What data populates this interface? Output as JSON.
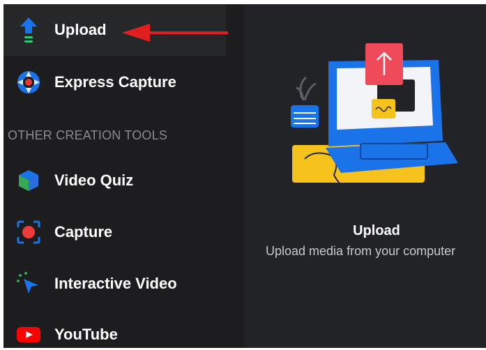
{
  "sidebar": {
    "items": [
      {
        "label": "Upload",
        "icon": "upload-icon"
      },
      {
        "label": "Express Capture",
        "icon": "express-capture-icon"
      }
    ],
    "section_heading": "OTHER CREATION TOOLS",
    "tools": [
      {
        "label": "Video Quiz",
        "icon": "video-quiz-icon"
      },
      {
        "label": "Capture",
        "icon": "capture-icon"
      },
      {
        "label": "Interactive Video",
        "icon": "interactive-video-icon"
      },
      {
        "label": "YouTube",
        "icon": "youtube-icon"
      }
    ]
  },
  "preview": {
    "title": "Upload",
    "subtitle": "Upload media from your computer"
  },
  "colors": {
    "accent_blue": "#1a73e8",
    "arrow_red": "#e02020",
    "youtube_red": "#ff0000",
    "illustration_yellow": "#f6c21c",
    "illustration_pink": "#ef4a5a"
  }
}
